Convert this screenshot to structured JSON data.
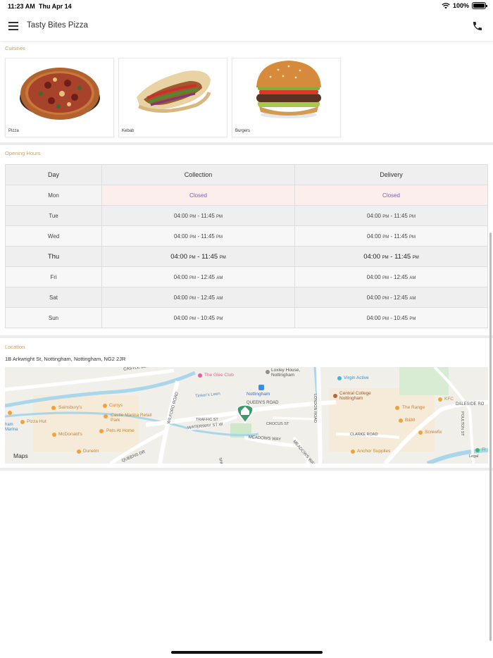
{
  "status_bar": {
    "time": "11:23 AM",
    "date": "Thu Apr 14",
    "battery": "100%"
  },
  "header": {
    "title": "Tasty Bites Pizza",
    "menu_icon": "hamburger-menu-icon",
    "call_icon": "phone-icon"
  },
  "cuisines": {
    "label": "Cuisines",
    "items": [
      {
        "name": "Pizza"
      },
      {
        "name": "Kebab"
      },
      {
        "name": "Burgers"
      }
    ]
  },
  "opening_hours": {
    "label": "Opening Hours",
    "columns": [
      "Day",
      "Collection",
      "Delivery"
    ],
    "rows": [
      {
        "day": "Mon",
        "collection": "Closed",
        "delivery": "Closed"
      },
      {
        "day": "Tue",
        "collection": {
          "open": "04:00",
          "open_ampm": "PM",
          "close": "11:45",
          "close_ampm": "PM"
        },
        "delivery": {
          "open": "04:00",
          "open_ampm": "PM",
          "close": "11:45",
          "close_ampm": "PM"
        }
      },
      {
        "day": "Wed",
        "collection": {
          "open": "04:00",
          "open_ampm": "PM",
          "close": "11:45",
          "close_ampm": "PM"
        },
        "delivery": {
          "open": "04:00",
          "open_ampm": "PM",
          "close": "11:45",
          "close_ampm": "PM"
        }
      },
      {
        "day": "Thu",
        "collection": {
          "open": "04:00",
          "open_ampm": "PM",
          "close": "11:45",
          "close_ampm": "PM"
        },
        "delivery": {
          "open": "04:00",
          "open_ampm": "PM",
          "close": "11:45",
          "close_ampm": "PM"
        }
      },
      {
        "day": "Fri",
        "collection": {
          "open": "04:00",
          "open_ampm": "PM",
          "close": "12:45",
          "close_ampm": "AM"
        },
        "delivery": {
          "open": "04:00",
          "open_ampm": "PM",
          "close": "12:45",
          "close_ampm": "AM"
        }
      },
      {
        "day": "Sat",
        "collection": {
          "open": "04:00",
          "open_ampm": "PM",
          "close": "12:45",
          "close_ampm": "AM"
        },
        "delivery": {
          "open": "04:00",
          "open_ampm": "PM",
          "close": "12:45",
          "close_ampm": "AM"
        }
      },
      {
        "day": "Sun",
        "collection": {
          "open": "04:00",
          "open_ampm": "PM",
          "close": "10:45",
          "close_ampm": "PM"
        },
        "delivery": {
          "open": "04:00",
          "open_ampm": "PM",
          "close": "10:45",
          "close_ampm": "PM"
        }
      }
    ]
  },
  "location": {
    "label": "Location",
    "address": "1B Arkwright St, Nottingham, Nottingham, NG2 2JR",
    "map": {
      "attribution": "Maps",
      "legal": "Legal",
      "streets": [
        "CASTLE BLVD",
        "WILFORD ROAD",
        "Tinker's Leen",
        "TRAFFIC ST",
        "WATERWAY ST W",
        "QUEEN'S ROAD",
        "CROCUS ST",
        "MEADOWS WAY",
        "QUEENS DR",
        "MEADOWS WAY",
        "LONDON ROAD",
        "CLARKE ROAD",
        "DALESIDE RO",
        "POULTON ST",
        "SHE"
      ],
      "places": [
        "The Glee Club",
        "Loxley House, Nottingham",
        "Nottingham",
        "Virgin Active",
        "Central College Nottingham",
        "The Range",
        "KFC",
        "B&M",
        "Screwfix",
        "Anchor Supplies",
        "Sainsbury's",
        "Currys",
        "Castle Marina Retail Park",
        "Pizza Hut",
        "McDonald's",
        "Pets At Home",
        "Dunelm",
        "ham Marina",
        "Fl"
      ]
    }
  },
  "colors": {
    "section_label": "#c4a56a",
    "closed_text": "#6e5fb8",
    "closed_bg": "#fdeeee",
    "map_pin": "#3a9a6a"
  }
}
